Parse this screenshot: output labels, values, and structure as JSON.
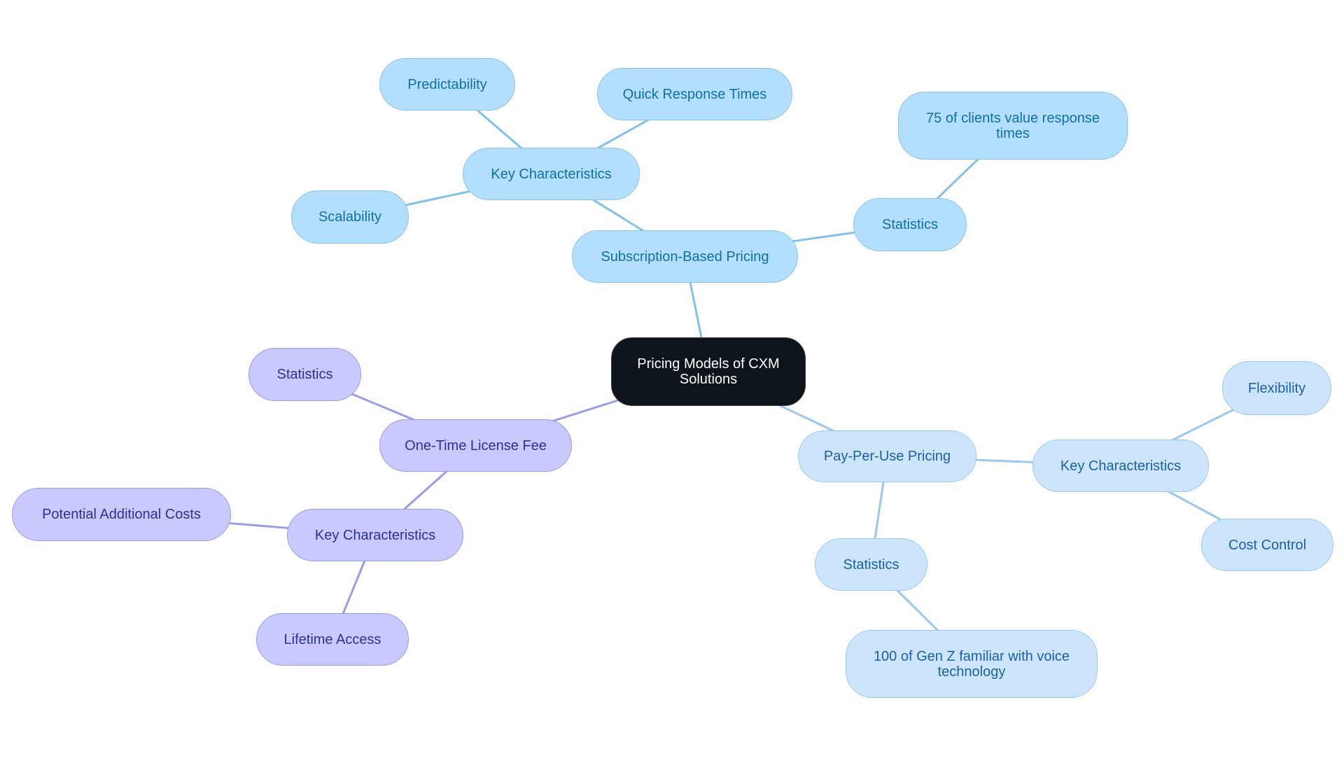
{
  "title": "Pricing Models of CXM Solutions",
  "colors": {
    "root_bg": "#0d141c",
    "subscription": "#b3dffc",
    "pay_per_use": "#cde5fb",
    "one_time": "#c8c9fd",
    "edge_subscription": "#84bfe6",
    "edge_pay_per_use": "#9cc6ec",
    "edge_one_time": "#9a9ce4"
  },
  "nodes": {
    "root": {
      "label": "Pricing Models of CXM Solutions"
    },
    "subscription": {
      "label": "Subscription-Based Pricing"
    },
    "sub_key": {
      "label": "Key Characteristics"
    },
    "sub_predictability": {
      "label": "Predictability"
    },
    "sub_quick": {
      "label": "Quick Response Times"
    },
    "sub_scalability": {
      "label": "Scalability"
    },
    "sub_stats": {
      "label": "Statistics"
    },
    "sub_stat_75": {
      "label": "75 of clients value response times"
    },
    "ppu": {
      "label": "Pay-Per-Use Pricing"
    },
    "ppu_key": {
      "label": "Key Characteristics"
    },
    "ppu_flex": {
      "label": "Flexibility"
    },
    "ppu_cost": {
      "label": "Cost Control"
    },
    "ppu_stats": {
      "label": "Statistics"
    },
    "ppu_stat_genz": {
      "label": "100 of Gen Z familiar with voice technology"
    },
    "otl": {
      "label": "One-Time License Fee"
    },
    "otl_stats": {
      "label": "Statistics"
    },
    "otl_key": {
      "label": "Key Characteristics"
    },
    "otl_potential": {
      "label": "Potential Additional Costs"
    },
    "otl_lifetime": {
      "label": "Lifetime Access"
    }
  },
  "edges": [
    [
      "root",
      "subscription",
      "edge_subscription"
    ],
    [
      "subscription",
      "sub_key",
      "edge_subscription"
    ],
    [
      "sub_key",
      "sub_predictability",
      "edge_subscription"
    ],
    [
      "sub_key",
      "sub_quick",
      "edge_subscription"
    ],
    [
      "sub_key",
      "sub_scalability",
      "edge_subscription"
    ],
    [
      "subscription",
      "sub_stats",
      "edge_subscription"
    ],
    [
      "sub_stats",
      "sub_stat_75",
      "edge_subscription"
    ],
    [
      "root",
      "ppu",
      "edge_pay_per_use"
    ],
    [
      "ppu",
      "ppu_key",
      "edge_pay_per_use"
    ],
    [
      "ppu_key",
      "ppu_flex",
      "edge_pay_per_use"
    ],
    [
      "ppu_key",
      "ppu_cost",
      "edge_pay_per_use"
    ],
    [
      "ppu",
      "ppu_stats",
      "edge_pay_per_use"
    ],
    [
      "ppu_stats",
      "ppu_stat_genz",
      "edge_pay_per_use"
    ],
    [
      "root",
      "otl",
      "edge_one_time"
    ],
    [
      "otl",
      "otl_stats",
      "edge_one_time"
    ],
    [
      "otl",
      "otl_key",
      "edge_one_time"
    ],
    [
      "otl_key",
      "otl_potential",
      "edge_one_time"
    ],
    [
      "otl_key",
      "otl_lifetime",
      "edge_one_time"
    ]
  ]
}
